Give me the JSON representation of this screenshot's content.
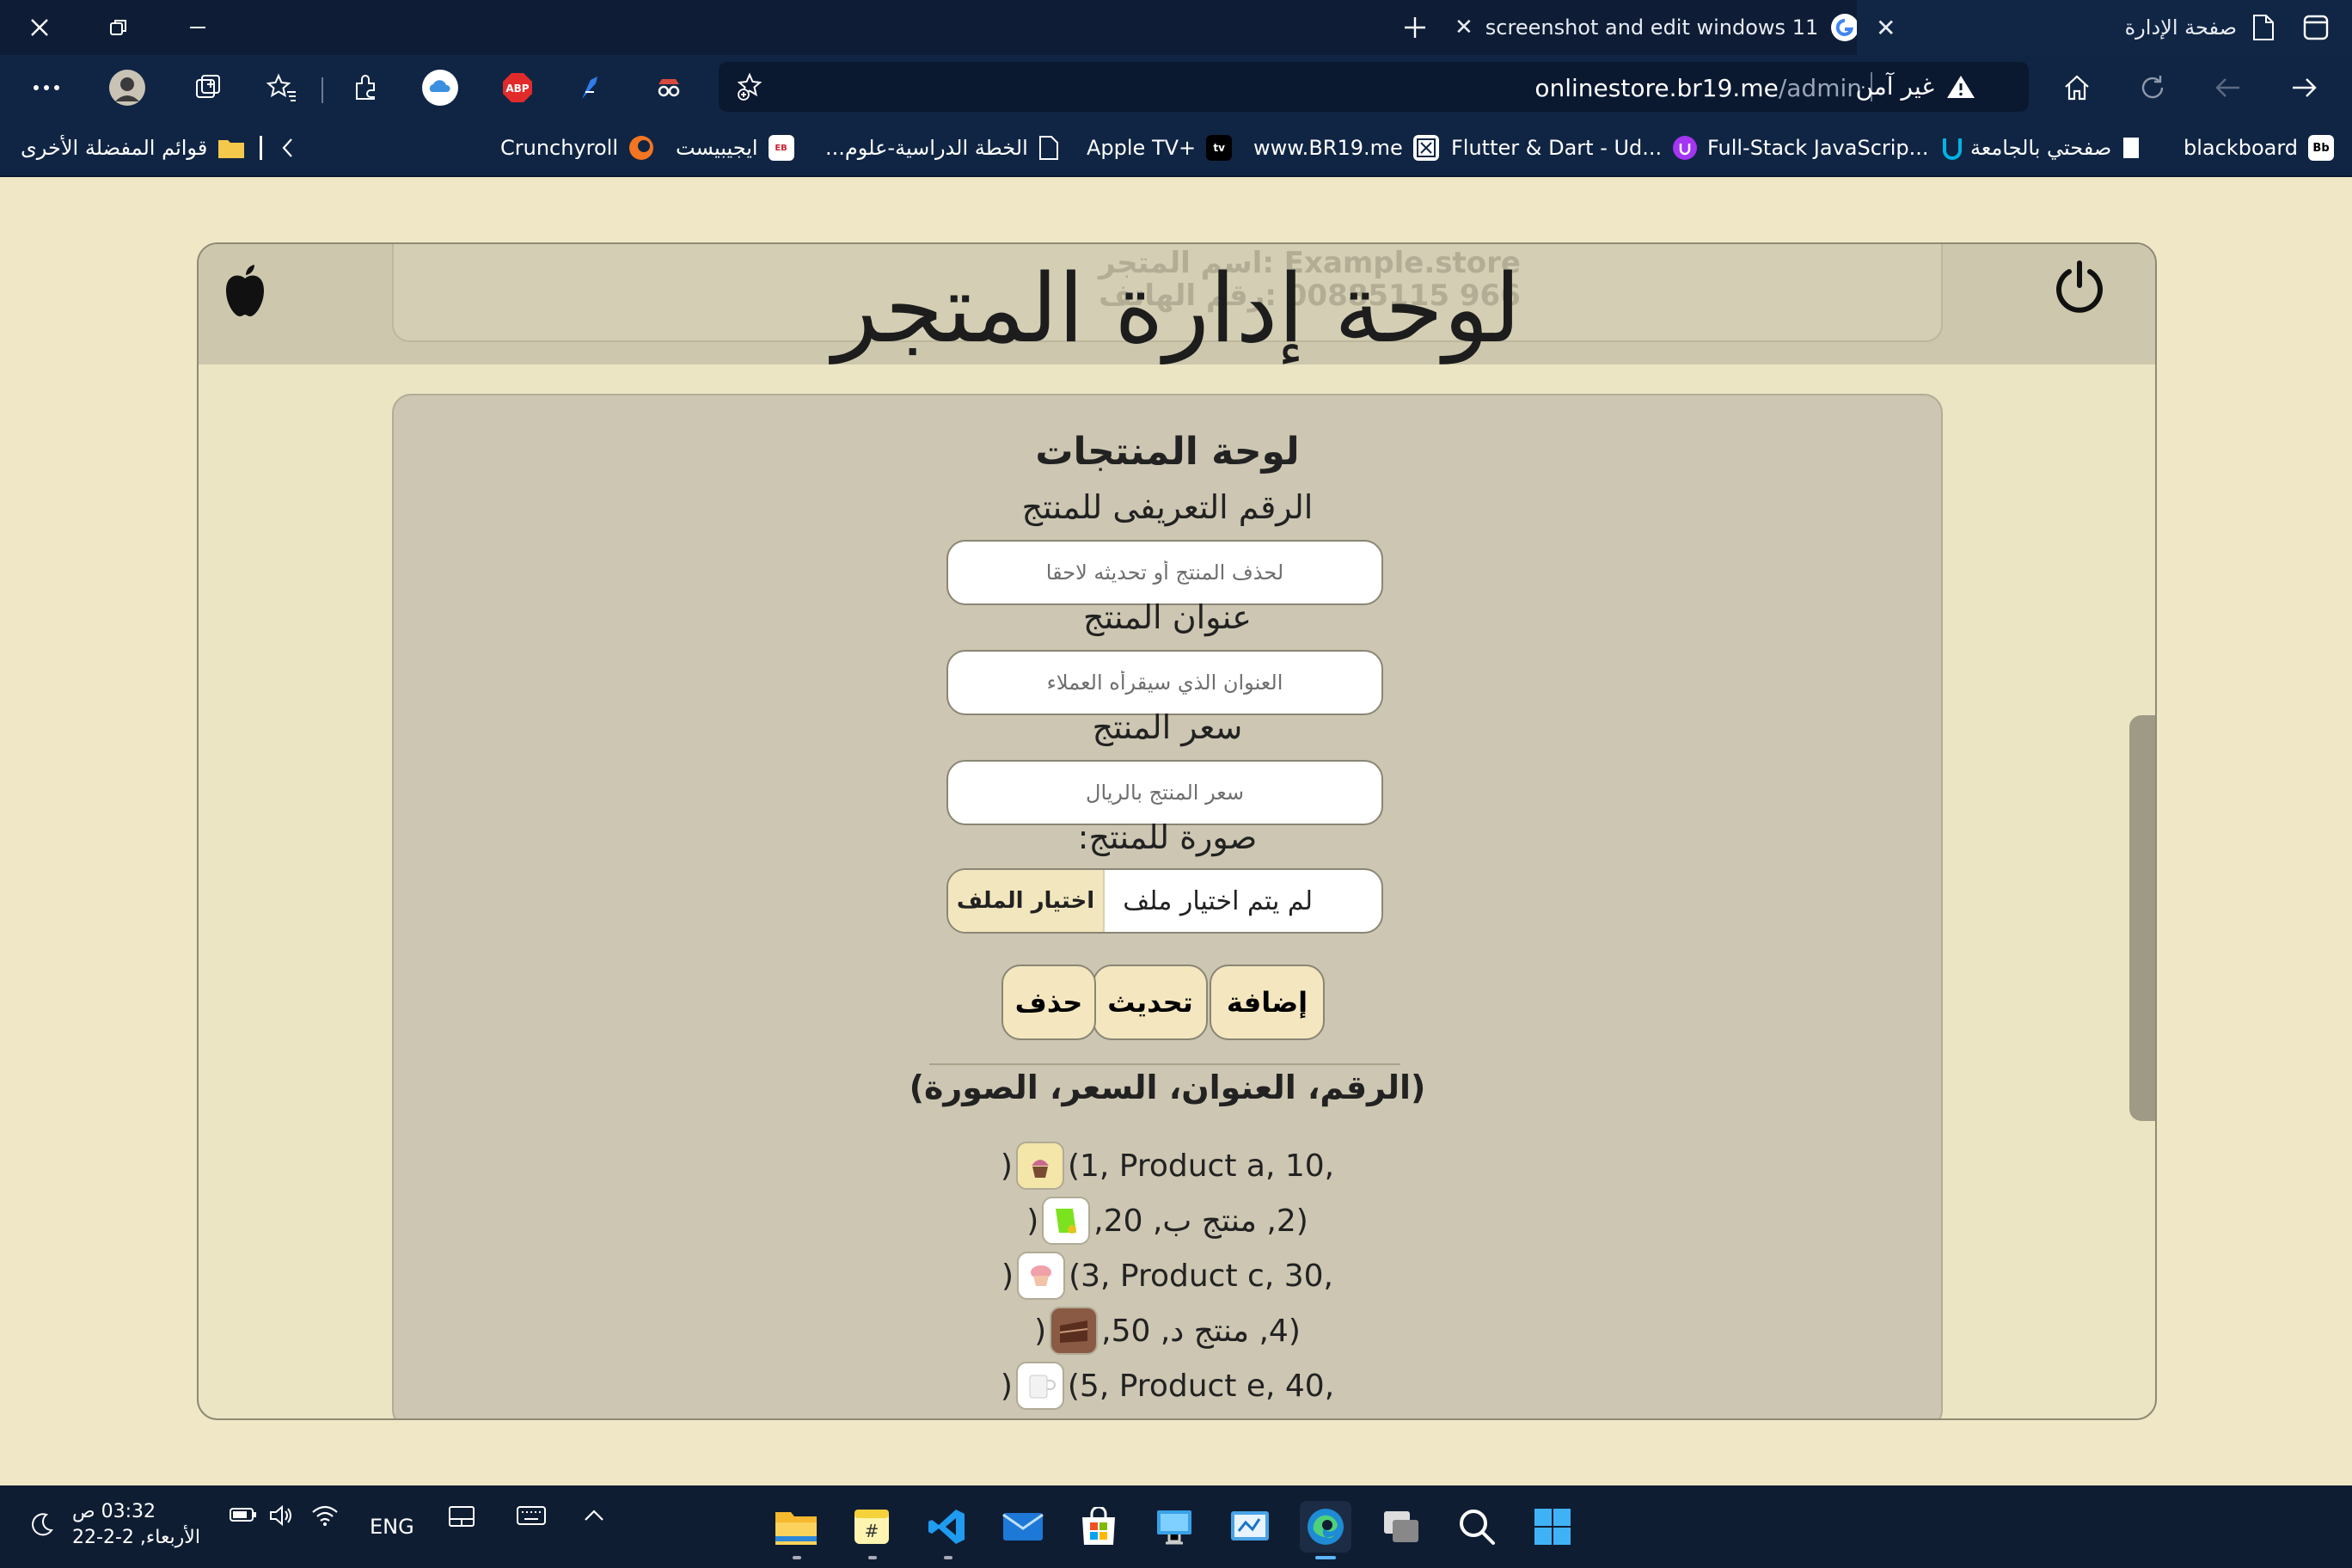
{
  "browser": {
    "tabs": [
      {
        "title": "صفحة الإدارة",
        "active": true
      },
      {
        "title": "screenshot and edit windows 11",
        "active": false
      }
    ],
    "url_host": "onlinestore.br19.me",
    "url_path": "/admin",
    "security_label": "غير آمن",
    "favorites": [
      {
        "label": "blackboard"
      },
      {
        "label": "صفحتي بالجامعة"
      },
      {
        "label": "Full-Stack JavaScrip..."
      },
      {
        "label": "Flutter & Dart - Ud..."
      },
      {
        "label": "www.BR19.me"
      },
      {
        "label": "Apple TV+"
      },
      {
        "label": "الخطة الدراسية-علوم..."
      },
      {
        "label": "ايجيبيست"
      },
      {
        "label": "Crunchyroll"
      }
    ],
    "other_favorites": "قوائم المفضلة الأخرى",
    "extension_abp": "ABP"
  },
  "page": {
    "title": "لوحة إدارة المتجر",
    "ghost_lines": [
      "Example.store :اسم المتجر",
      "966 00885115 :رقم الهاتف"
    ]
  },
  "form": {
    "heading": "لوحة المنتجات",
    "id_label": "الرقم التعريفى للمنتج",
    "id_placeholder": "لحذف المنتج أو تحديثه لاحقا",
    "title_label": "عنوان المنتج",
    "title_placeholder": "العنوان الذي سيقرأه العملاء",
    "price_label": "سعر المنتج",
    "price_placeholder": "سعر المنتج بالريال",
    "image_label": "صورة للمنتج:",
    "file_button": "اختيار الملف",
    "file_status": "لم يتم اختيار ملف",
    "buttons": {
      "add": "إضافة",
      "update": "تحديث",
      "delete": "حذف"
    }
  },
  "products": {
    "heading": "(الرقم، العنوان، السعر، الصورة)",
    "rows": [
      {
        "text_before": "(1, Product a, 10, ",
        "text_after": ")",
        "image": "cupcake"
      },
      {
        "text_before": "(2, منتج ب, 20, ",
        "text_after": ")",
        "image": "green-bag"
      },
      {
        "text_before": "(3, Product c, 30, ",
        "text_after": ")",
        "image": "muffin"
      },
      {
        "text_before": "(4, منتج د, 50, ",
        "text_after": ")",
        "image": "chocolate-cake"
      },
      {
        "text_before": "(5, Product e, 40, ",
        "text_after": ")",
        "image": "white-mug"
      }
    ]
  },
  "taskbar": {
    "language": "ENG",
    "time": "03:32 ص",
    "date": "الأربعاء, 2-2-22"
  },
  "colors": {
    "page_bg": "#efe7c6",
    "header_bg": "#cdc7ad",
    "card_bg": "#ccc6b2",
    "button_bg": "#f4e7bf",
    "browser_dark": "#0e1d35"
  }
}
